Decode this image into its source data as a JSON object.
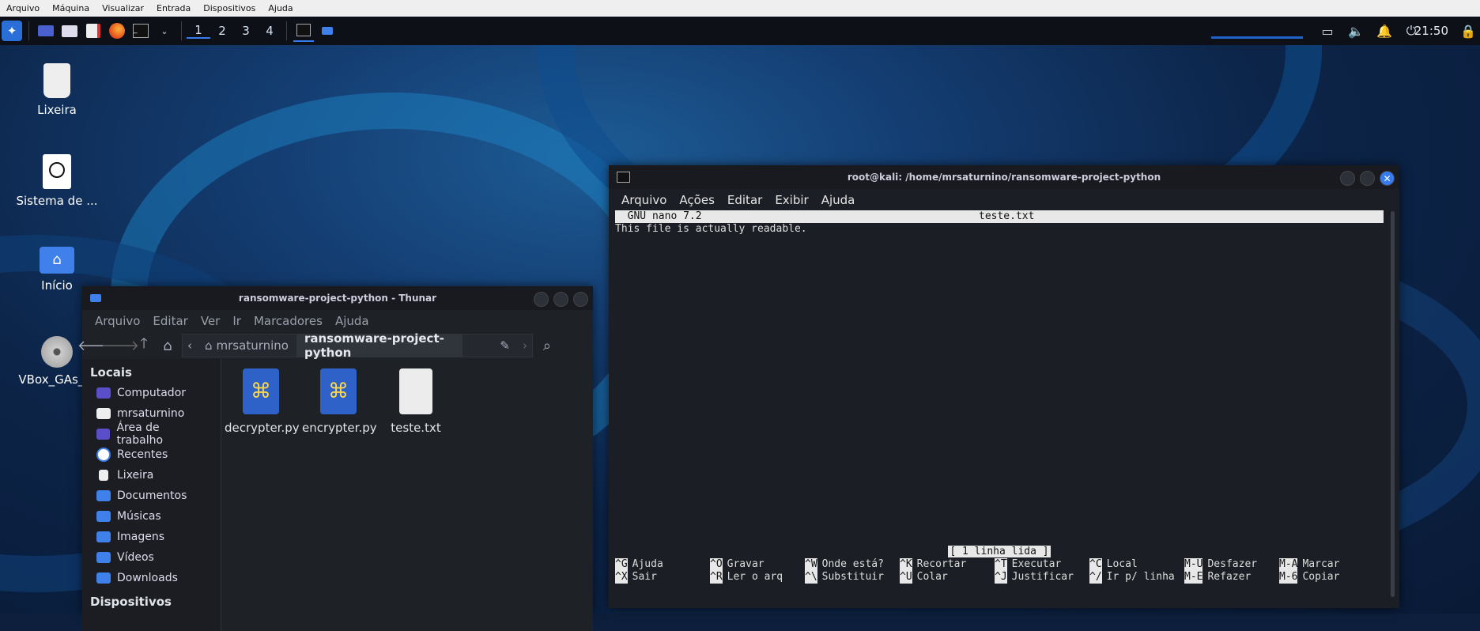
{
  "vm_menu": [
    "Arquivo",
    "Máquina",
    "Visualizar",
    "Entrada",
    "Dispositivos",
    "Ajuda"
  ],
  "panel": {
    "workspaces": [
      "1",
      "2",
      "3",
      "4"
    ],
    "clock": "21:50"
  },
  "desktop_icons": [
    {
      "label": "Lixeira",
      "icon": "trash-icon"
    },
    {
      "label": "Sistema de ...",
      "icon": "filesystem-icon"
    },
    {
      "label": "Início",
      "icon": "home-folder-icon"
    },
    {
      "label": "VBox_GAs_...",
      "icon": "disc-icon"
    }
  ],
  "thunar": {
    "title": "ransomware-project-python - Thunar",
    "menu": [
      "Arquivo",
      "Editar",
      "Ver",
      "Ir",
      "Marcadores",
      "Ajuda"
    ],
    "breadcrumb": [
      "mrsaturnino",
      "ransomware-project-python"
    ],
    "sidebar_heading": "Locais",
    "sidebar": [
      "Computador",
      "mrsaturnino",
      "Área de trabalho",
      "Recentes",
      "Lixeira",
      "Documentos",
      "Músicas",
      "Imagens",
      "Vídeos",
      "Downloads"
    ],
    "sidebar_heading2": "Dispositivos",
    "files": [
      {
        "name": "decrypter.py",
        "type": "python"
      },
      {
        "name": "encrypter.py",
        "type": "python"
      },
      {
        "name": "teste.txt",
        "type": "text"
      }
    ]
  },
  "terminal": {
    "title": "root@kali: /home/mrsaturnino/ransomware-project-python",
    "menu": [
      "Arquivo",
      "Ações",
      "Editar",
      "Exibir",
      "Ajuda"
    ],
    "nano_version": "  GNU nano 7.2",
    "nano_file": "teste.txt",
    "content": "This file is actually readable.",
    "status": "[ 1 linha lida ]",
    "shortcuts_row1": [
      [
        "^G",
        "Ajuda"
      ],
      [
        "^O",
        "Gravar"
      ],
      [
        "^W",
        "Onde está?"
      ],
      [
        "^K",
        "Recortar"
      ],
      [
        "^T",
        "Executar"
      ],
      [
        "^C",
        "Local"
      ],
      [
        "M-U",
        "Desfazer"
      ],
      [
        "M-A",
        "Marcar"
      ]
    ],
    "shortcuts_row2": [
      [
        "^X",
        "Sair"
      ],
      [
        "^R",
        "Ler o arq"
      ],
      [
        "^\\",
        "Substituir"
      ],
      [
        "^U",
        "Colar"
      ],
      [
        "^J",
        "Justificar"
      ],
      [
        "^/",
        "Ir p/ linha"
      ],
      [
        "M-E",
        "Refazer"
      ],
      [
        "M-6",
        "Copiar"
      ]
    ]
  }
}
